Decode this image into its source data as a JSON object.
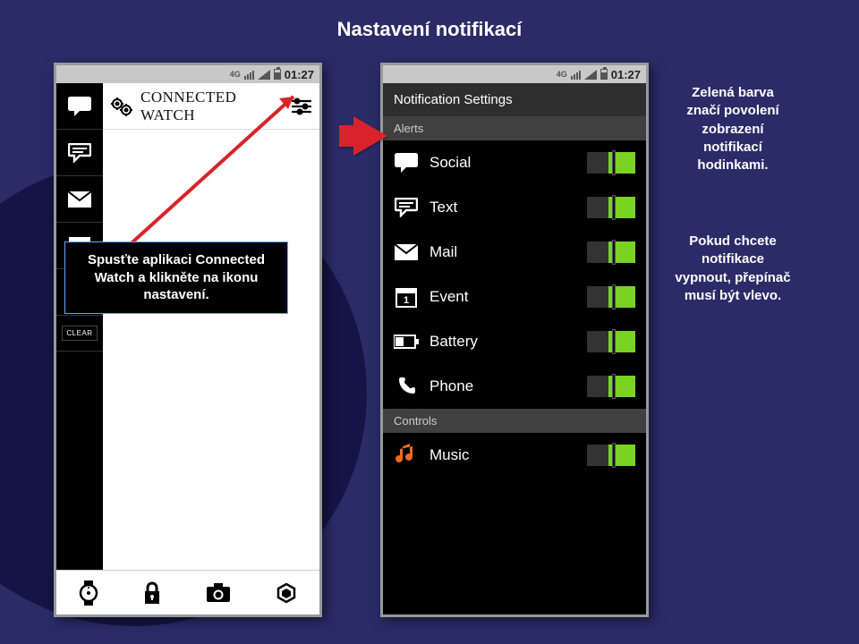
{
  "page_title": "Nastavení notifikací",
  "status": {
    "net_label": "4G",
    "time": "01:27"
  },
  "phone1": {
    "header_title": "CONNECTED WATCH",
    "sidebar": {
      "items": [
        {
          "name": "chat-icon"
        },
        {
          "name": "sms-icon"
        },
        {
          "name": "mail-icon"
        },
        {
          "name": "calendar-icon"
        },
        {
          "name": "call-icon"
        }
      ],
      "clear_label": "CLEAR"
    },
    "bottom_icons": [
      {
        "name": "watch-icon"
      },
      {
        "name": "lock-icon"
      },
      {
        "name": "camera-icon"
      },
      {
        "name": "hex-icon"
      }
    ]
  },
  "phone2": {
    "title": "Notification Settings",
    "sections": [
      {
        "label": "Alerts",
        "rows": [
          {
            "icon": "chat-icon",
            "label": "Social",
            "on": true
          },
          {
            "icon": "sms-icon",
            "label": "Text",
            "on": true
          },
          {
            "icon": "mail-icon",
            "label": "Mail",
            "on": true
          },
          {
            "icon": "calendar-icon",
            "label": "Event",
            "on": true
          },
          {
            "icon": "battery-icon",
            "label": "Battery",
            "on": true
          },
          {
            "icon": "phone-icon",
            "label": "Phone",
            "on": true
          }
        ]
      },
      {
        "label": "Controls",
        "rows": [
          {
            "icon": "music-icon",
            "label": "Music",
            "on": true
          }
        ]
      }
    ]
  },
  "callouts": {
    "open_settings": "Spusťte aplikaci Connected Watch a klikněte na ikonu nastavení.",
    "green_means_on": "Zelená barva značí povolení zobrazení notifikací hodinkami.",
    "switch_off": "Pokud chcete notifikace vypnout, přepínač musí být vlevo."
  },
  "colors": {
    "bg": "#2b2b68",
    "bg_dark": "#151545",
    "toggle_on": "#7bd321",
    "arrow": "#d8232a",
    "music_icon": "#ef6a1f"
  }
}
